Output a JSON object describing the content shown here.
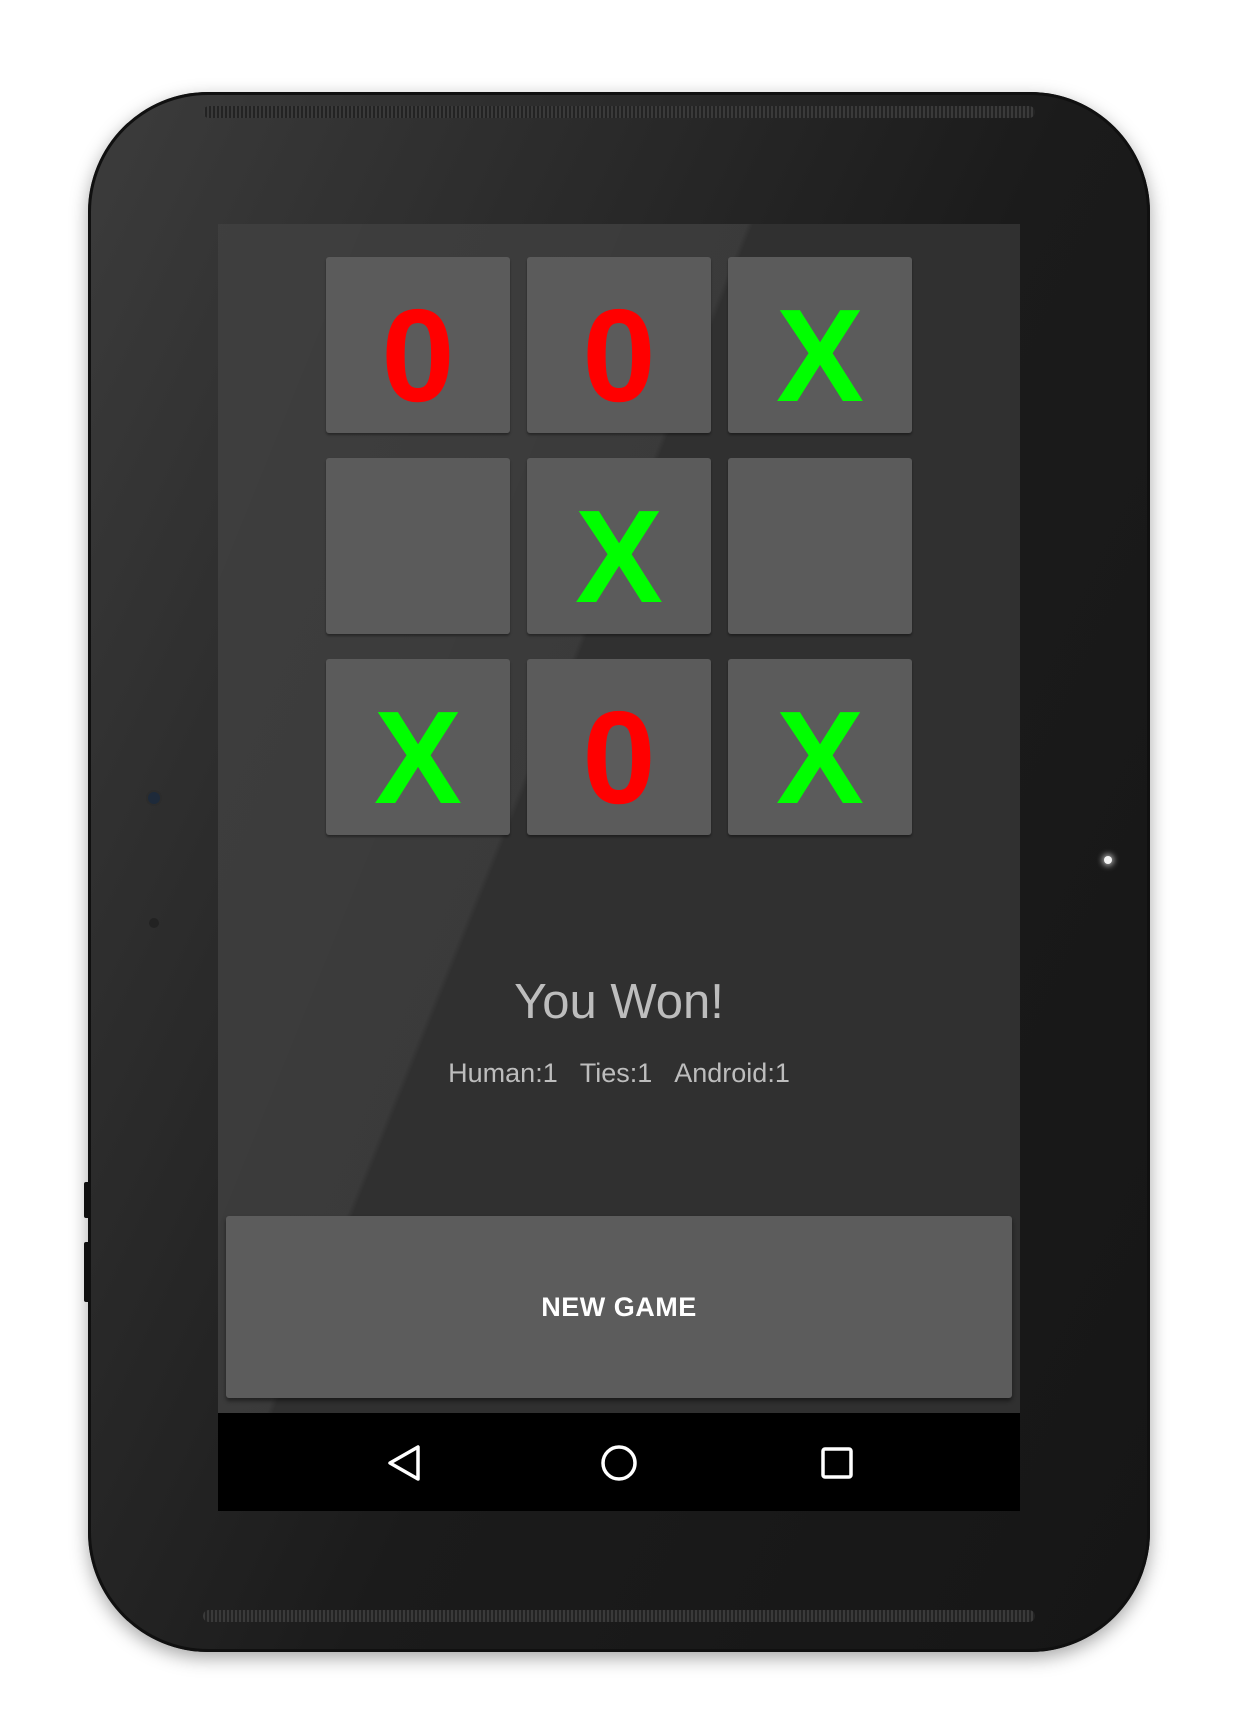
{
  "board": {
    "cells": [
      "0",
      "0",
      "X",
      "",
      "X",
      "",
      "X",
      "0",
      "X"
    ],
    "colors": {
      "X": "#00ff00",
      "0": "#ff0000"
    }
  },
  "status": {
    "message": "You Won!"
  },
  "scores": {
    "human": "Human:1",
    "ties": "Ties:1",
    "android": "Android:1"
  },
  "actions": {
    "new_game_label": "NEW GAME"
  },
  "navigation": {
    "back_icon": "back-triangle-icon",
    "home_icon": "home-circle-icon",
    "recents_icon": "recents-square-icon"
  },
  "theme": {
    "screen_bg": "#303030",
    "cell_bg": "#5b5b5b",
    "text_color": "#bdbdbd"
  }
}
